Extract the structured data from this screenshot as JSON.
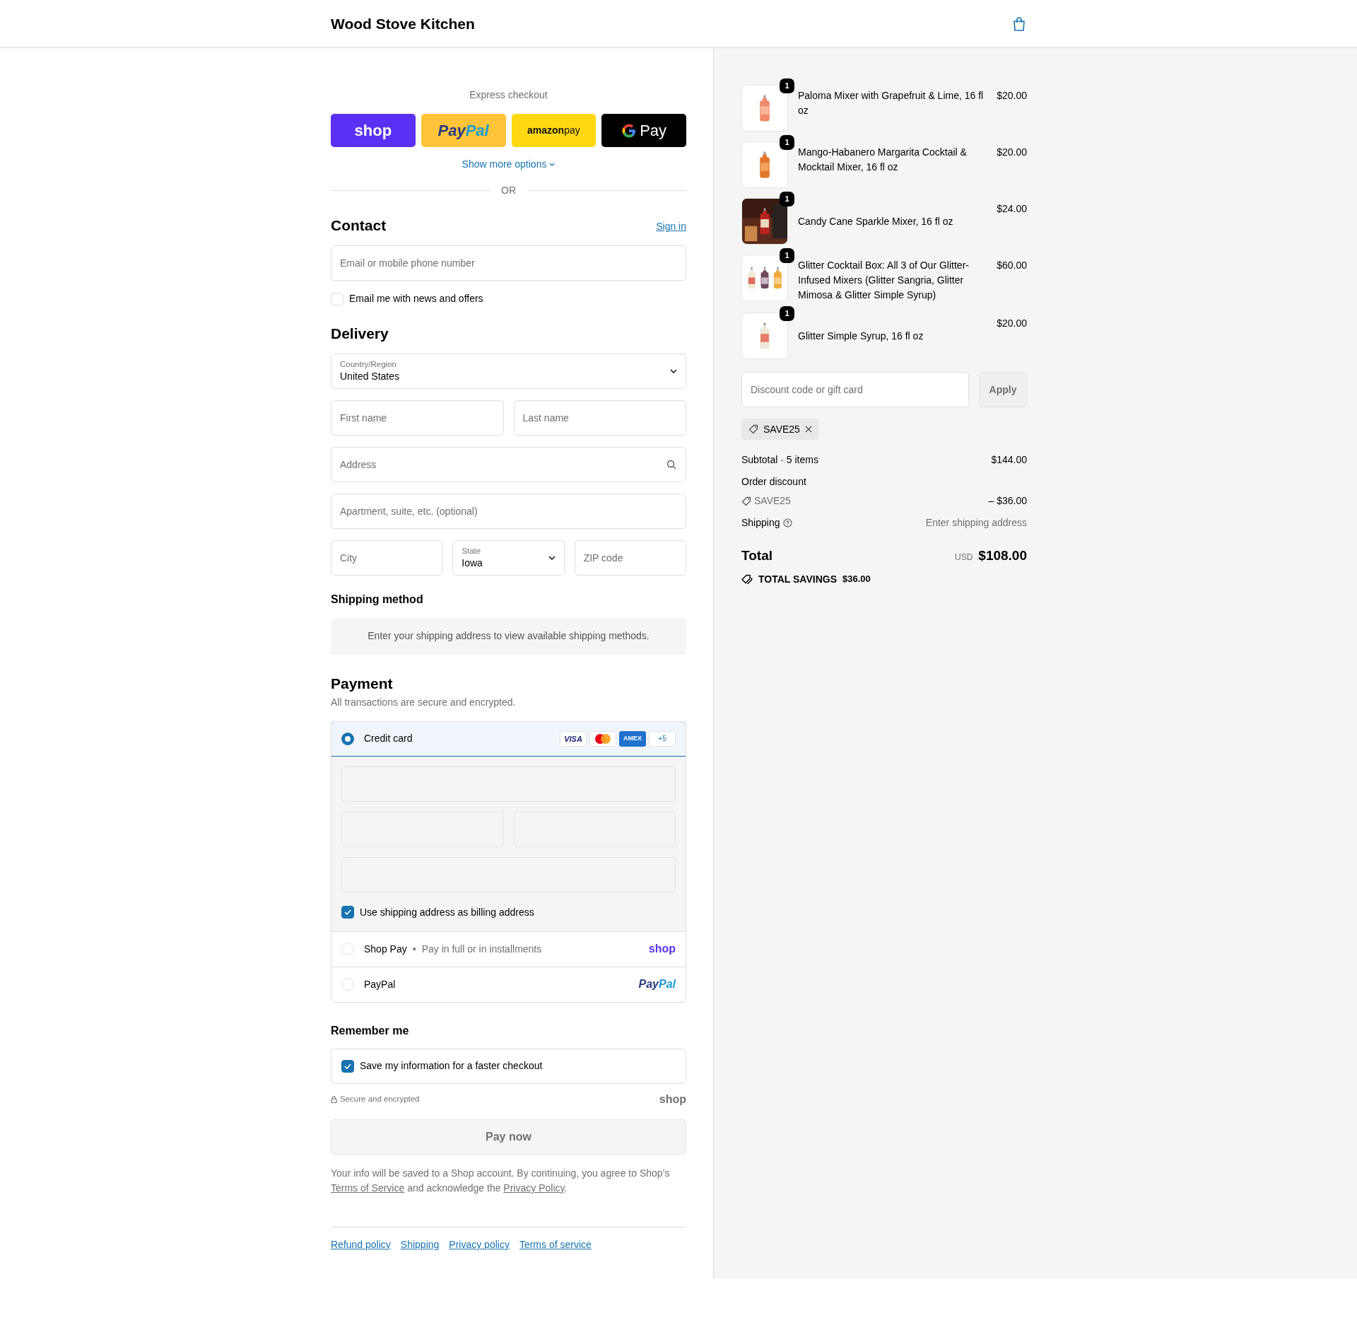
{
  "header": {
    "store_name": "Wood Stove Kitchen"
  },
  "express_checkout": {
    "label": "Express checkout",
    "buttons": [
      {
        "kind": "shop",
        "parts": [
          "shop"
        ]
      },
      {
        "kind": "paypal",
        "parts": [
          "Pay",
          "Pal"
        ]
      },
      {
        "kind": "amazon",
        "parts": [
          "amazon",
          "pay"
        ]
      },
      {
        "kind": "gpay",
        "parts": [
          "Pay"
        ]
      }
    ],
    "more_options": "Show more options",
    "divider": "OR"
  },
  "contact": {
    "title": "Contact",
    "sign_in": "Sign in",
    "email": {
      "placeholder": "Email or mobile phone number"
    },
    "newsletter": {
      "label": "Email me with news and offers",
      "checked": false
    }
  },
  "delivery": {
    "title": "Delivery",
    "country": {
      "label": "Country/Region",
      "value": "United States"
    },
    "first_name": {
      "placeholder": "First name"
    },
    "last_name": {
      "placeholder": "Last name"
    },
    "address": {
      "placeholder": "Address"
    },
    "apartment": {
      "placeholder": "Apartment, suite, etc. (optional)"
    },
    "city": {
      "placeholder": "City"
    },
    "state": {
      "label": "State",
      "value": "Iowa"
    },
    "zip": {
      "placeholder": "ZIP code"
    }
  },
  "shipping_method": {
    "title": "Shipping method",
    "message": "Enter your shipping address to view available shipping methods."
  },
  "payment": {
    "title": "Payment",
    "subtitle": "All transactions are secure and encrypted.",
    "methods": [
      {
        "kind": "card",
        "label": "Credit card",
        "selected": true,
        "brands": [
          {
            "kind": "visa",
            "label": "VISA"
          },
          {
            "kind": "mastercard"
          },
          {
            "kind": "amex",
            "label": "AMEX"
          },
          {
            "kind": "more",
            "label": "+5"
          }
        ],
        "fields": [
          {
            "kind": "wide"
          },
          {
            "kind": "half"
          },
          {
            "kind": "half"
          },
          {
            "kind": "wide"
          }
        ],
        "billing_same": {
          "label": "Use shipping address as billing address",
          "checked": true
        }
      },
      {
        "kind": "shop_pay",
        "label": "Shop Pay",
        "separator": "•",
        "detail": "Pay in full or in installments",
        "logo": [
          "shop"
        ],
        "selected": false
      },
      {
        "kind": "paypal",
        "label": "PayPal",
        "logo": [
          "Pay",
          "Pal"
        ],
        "selected": false
      }
    ]
  },
  "remember_me": {
    "title": "Remember me",
    "save_info": {
      "label": "Save my information for a faster checkout",
      "checked": true
    },
    "secure_note": "Secure and encrypted",
    "logo": "shop"
  },
  "pay_button": {
    "label": "Pay now",
    "disabled": true
  },
  "terms": [
    {
      "text": "Your info will be saved to a Shop account. By continuing, you agree to Shop’s "
    },
    {
      "text": "Terms of Service",
      "link": true
    },
    {
      "text": " and acknowledge the "
    },
    {
      "text": "Privacy Policy",
      "link": true
    },
    {
      "text": "."
    }
  ],
  "footer_links": [
    "Refund policy",
    "Shipping",
    "Privacy policy",
    "Terms of service"
  ],
  "order_summary": {
    "items": [
      {
        "quantity": "1",
        "name": "Paloma Mixer with Grapefruit & Lime, 16 fl oz",
        "price": "$20.00"
      },
      {
        "quantity": "1",
        "name": "Mango-Habanero Margarita Cocktail & Mocktail Mixer, 16 fl oz",
        "price": "$20.00"
      },
      {
        "quantity": "1",
        "name": "Candy Cane Sparkle Mixer, 16 fl oz",
        "price": "$24.00"
      },
      {
        "quantity": "1",
        "name": "Glitter Cocktail Box: All 3 of Our Glitter-Infused Mixers (Glitter Sangria, Glitter Mimosa & Glitter Simple Syrup)",
        "price": "$60.00"
      },
      {
        "quantity": "1",
        "name": "Glitter Simple Syrup, 16 fl oz",
        "price": "$20.00"
      }
    ],
    "discount": {
      "placeholder": "Discount code or gift card",
      "apply": "Apply"
    },
    "applied_code": "SAVE25",
    "subtotal": {
      "label": "Subtotal · 5 items",
      "value": "$144.00"
    },
    "order_discount": {
      "label": "Order discount",
      "code": "SAVE25",
      "value": "– $36.00"
    },
    "shipping": {
      "label": "Shipping",
      "value": "Enter shipping address"
    },
    "total": {
      "label": "Total",
      "currency": "USD",
      "value": "$108.00"
    },
    "savings": {
      "label": "TOTAL SAVINGS",
      "value": "$36.00"
    }
  }
}
